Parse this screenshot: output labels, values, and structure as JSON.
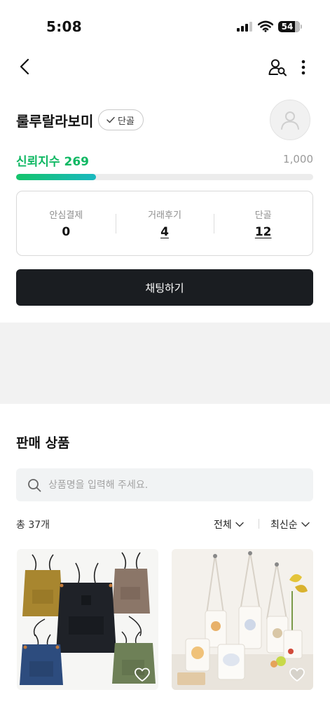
{
  "status_bar": {
    "time": "5:08",
    "battery": "54"
  },
  "profile": {
    "name": "룰루랄라보미",
    "badge_label": "단골",
    "trust_label": "신뢰지수",
    "trust_score": "269",
    "trust_max": "1,000",
    "trust_fraction": 0.269
  },
  "stats": [
    {
      "label": "안심결제",
      "value": "0",
      "link": false
    },
    {
      "label": "거래후기",
      "value": "4",
      "link": true
    },
    {
      "label": "단골",
      "value": "12",
      "link": true
    }
  ],
  "chat_button_label": "채팅하기",
  "products_section": {
    "title": "판매 상품",
    "search_placeholder": "상품명을 입력해 주세요.",
    "total_count": "총 37개",
    "filter_label": "전체",
    "sort_label": "최신순"
  },
  "colors": {
    "trust_green": "#0fb863",
    "chat_button_bg": "#1a1d21"
  },
  "icons": [
    "back-icon",
    "user-search-icon",
    "more-vertical-icon",
    "check-icon",
    "avatar-placeholder-icon",
    "search-icon",
    "chevron-down-icon",
    "heart-icon"
  ]
}
